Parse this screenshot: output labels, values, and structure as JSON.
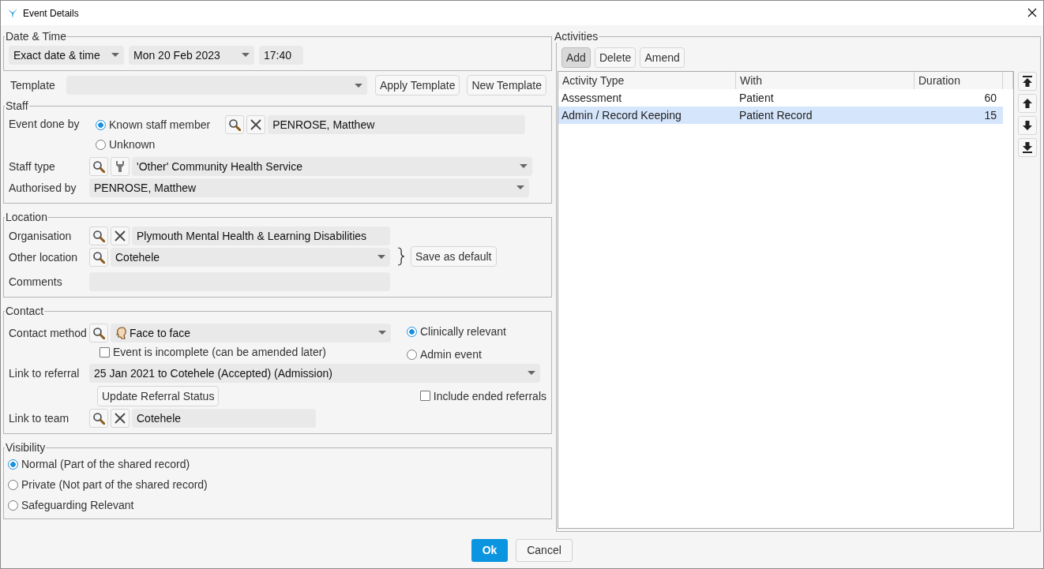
{
  "window": {
    "title": "Event Details"
  },
  "date_time": {
    "legend": "Date & Time",
    "mode": "Exact date & time",
    "date": "Mon 20 Feb 2023",
    "time": "17:40"
  },
  "template": {
    "label": "Template",
    "apply_button": "Apply Template",
    "new_button": "New Template"
  },
  "staff": {
    "legend": "Staff",
    "done_by_label": "Event done by",
    "done_by_options": [
      {
        "label": "Known staff member",
        "selected": true
      },
      {
        "label": "Unknown",
        "selected": false
      }
    ],
    "staff_member": "PENROSE, Matthew",
    "staff_type_label": "Staff type",
    "staff_type": "'Other' Community Health Service",
    "authorised_label": "Authorised by",
    "authorised_by": "PENROSE, Matthew"
  },
  "location": {
    "legend": "Location",
    "organisation_label": "Organisation",
    "organisation": "Plymouth Mental Health & Learning Disabilities",
    "other_label": "Other location",
    "other_location": "Cotehele",
    "save_default_button": "Save as default",
    "comments_label": "Comments"
  },
  "contact": {
    "legend": "Contact",
    "method_label": "Contact method",
    "method": "Face to face",
    "incomplete": {
      "label": "Event is incomplete (can be amended later)",
      "checked": false
    },
    "relevance_options": [
      {
        "label": "Clinically relevant",
        "selected": true
      },
      {
        "label": "Admin event",
        "selected": false
      }
    ],
    "referral_label": "Link to referral",
    "referral": "25 Jan 2021 to Cotehele (Accepted)  (Admission)",
    "update_button": "Update Referral Status",
    "include_ended": {
      "label": "Include ended referrals",
      "checked": false
    },
    "team_label": "Link to team",
    "team": "Cotehele"
  },
  "visibility": {
    "legend": "Visibility",
    "options": [
      {
        "label": "Normal (Part of the shared record)",
        "selected": true
      },
      {
        "label": "Private (Not part of the shared record)",
        "selected": false
      },
      {
        "label": "Safeguarding Relevant",
        "selected": false
      }
    ]
  },
  "activities": {
    "legend": "Activities",
    "buttons": [
      {
        "label": "Add",
        "pressed": true
      },
      {
        "label": "Delete",
        "pressed": false
      },
      {
        "label": "Amend",
        "pressed": false
      }
    ],
    "columns": [
      "Activity Type",
      "With",
      "Duration"
    ],
    "rows": [
      {
        "cells": [
          "Assessment",
          "Patient",
          "60"
        ],
        "selected": false
      },
      {
        "cells": [
          "Admin / Record Keeping",
          "Patient Record",
          "15"
        ],
        "selected": true
      }
    ]
  },
  "footer": {
    "ok": "Ok",
    "cancel": "Cancel"
  }
}
